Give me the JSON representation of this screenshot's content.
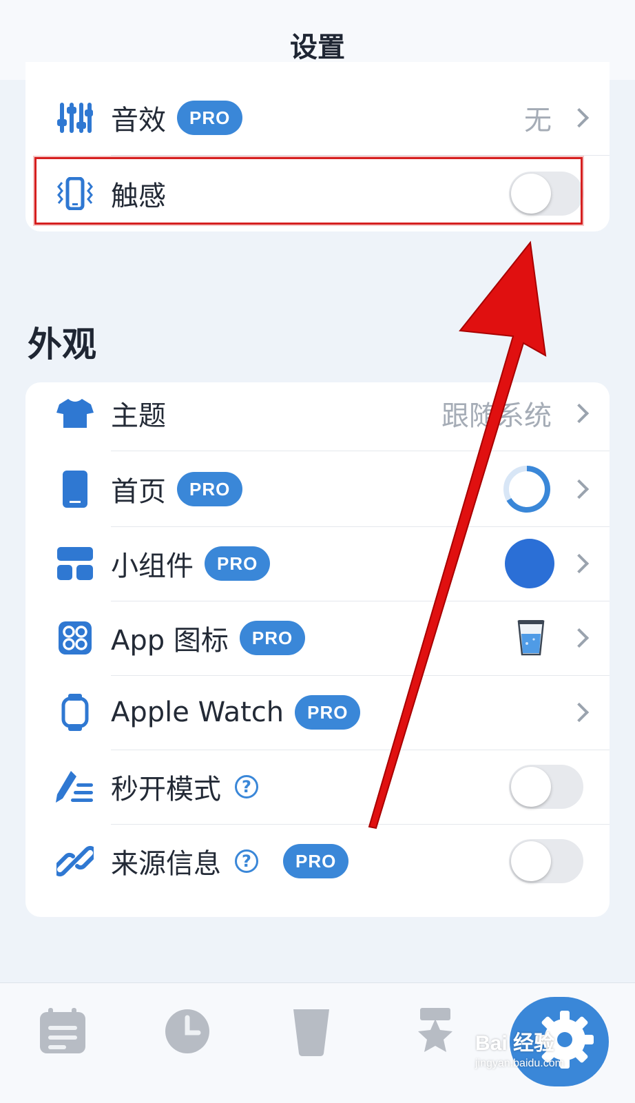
{
  "header": {
    "title": "设置"
  },
  "top_card": {
    "sound": {
      "label": "音效",
      "badge": "PRO",
      "value": "无",
      "icon": "sliders-icon"
    },
    "haptics": {
      "label": "触感",
      "icon": "phone-vibrate-icon",
      "on": false
    }
  },
  "appearance": {
    "title": "外观",
    "items": [
      {
        "label": "主题",
        "value": "跟随系统",
        "icon": "tshirt-icon"
      },
      {
        "label": "首页",
        "badge": "PRO",
        "icon": "phone-icon",
        "preview": "ring-icon"
      },
      {
        "label": "小组件",
        "badge": "PRO",
        "icon": "widget-icon",
        "preview": "blue-circle-icon"
      },
      {
        "label": "App 图标",
        "badge": "PRO",
        "icon": "app-grid-icon",
        "preview": "water-glass-icon"
      },
      {
        "label": "Apple Watch",
        "badge": "PRO",
        "icon": "watch-icon"
      },
      {
        "label": "秒开模式",
        "help": "?",
        "icon": "quick-pen-icon",
        "on": false
      },
      {
        "label": "来源信息",
        "help": "?",
        "badge": "PRO",
        "icon": "link-icon",
        "on": false
      }
    ]
  },
  "tabbar": {
    "tabs": [
      {
        "icon": "calendar-list-icon"
      },
      {
        "icon": "clock-icon"
      },
      {
        "icon": "cup-icon"
      },
      {
        "icon": "star-badge-icon"
      },
      {
        "icon": "gear-icon",
        "active": true
      }
    ]
  },
  "watermark": {
    "brand": "Bai 经验",
    "url": "jingyan.baidu.com"
  },
  "colors": {
    "accent": "#3a87d8",
    "background": "#eef3f9",
    "highlight": "#d61f1f",
    "arrow": "#e01010"
  }
}
